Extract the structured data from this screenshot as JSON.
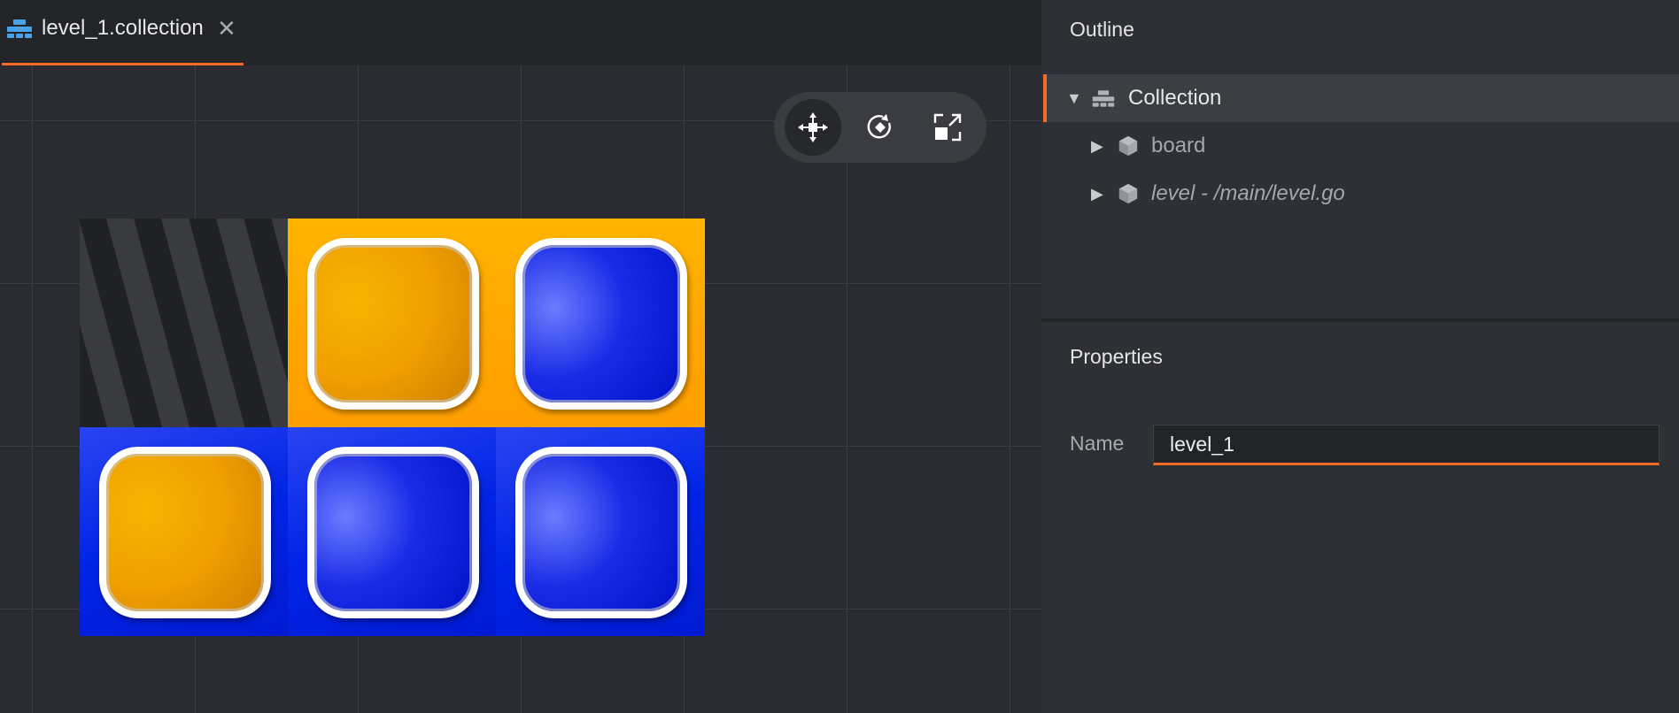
{
  "tab": {
    "title": "level_1.collection",
    "close_glyph": "✕",
    "icon": "collection-icon"
  },
  "viewport": {
    "tools": [
      {
        "name": "move-tool",
        "icon": "move-icon",
        "active": true
      },
      {
        "name": "rotate-tool",
        "icon": "rotate-icon",
        "active": false
      },
      {
        "name": "scale-tool",
        "icon": "scale-icon",
        "active": false
      }
    ],
    "board": {
      "rows": [
        [
          {
            "bg": "empty",
            "tile": null
          },
          {
            "bg": "orange",
            "tile": "orange"
          },
          {
            "bg": "orange",
            "tile": "blue"
          }
        ],
        [
          {
            "bg": "blue",
            "tile": "orange"
          },
          {
            "bg": "blue",
            "tile": "blue"
          },
          {
            "bg": "blue",
            "tile": "blue"
          }
        ]
      ]
    }
  },
  "outline": {
    "title": "Outline",
    "items": [
      {
        "label": "Collection",
        "icon": "collection-icon",
        "expanded": true,
        "selected": true
      },
      {
        "label": "board",
        "icon": "game-object-icon",
        "expanded": false
      },
      {
        "label": "level - /main/level.go",
        "icon": "game-object-icon",
        "expanded": false
      }
    ]
  },
  "properties": {
    "title": "Properties",
    "name_label": "Name",
    "name_value": "level_1"
  },
  "colors": {
    "accent": "#f26b29",
    "collection_icon": "#4aa3e8"
  }
}
